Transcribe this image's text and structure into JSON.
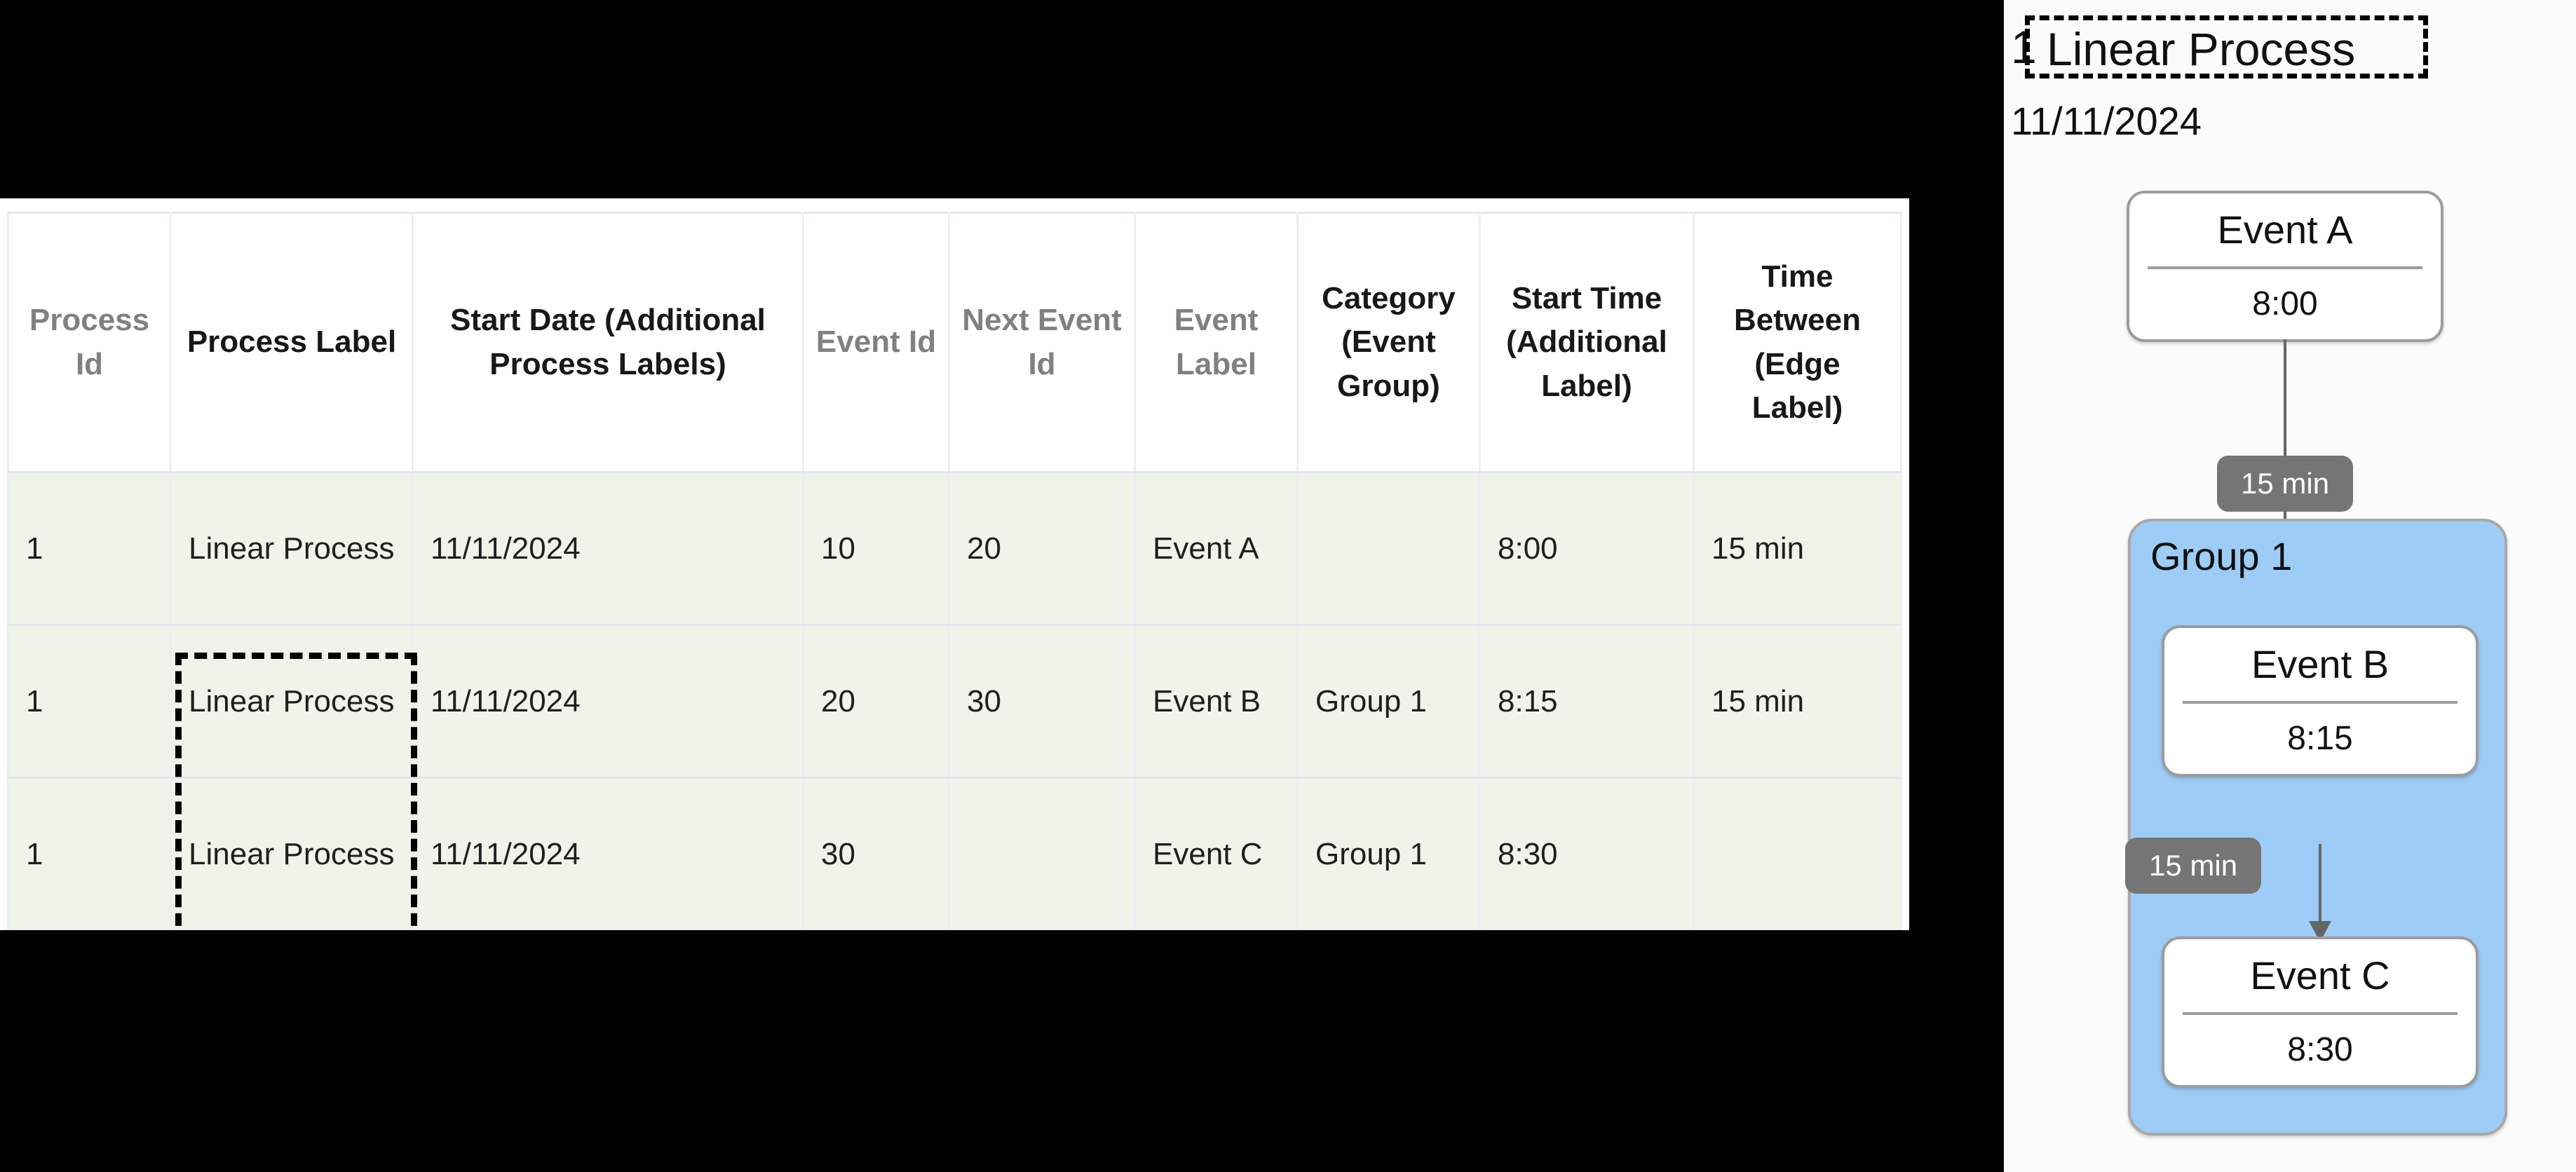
{
  "table": {
    "columns": [
      {
        "label": "Process Id",
        "style": "muted"
      },
      {
        "label": "Process Label",
        "style": "bold"
      },
      {
        "label": "Start Date (Additional Process Labels)",
        "style": "bold"
      },
      {
        "label": "Event Id",
        "style": "muted"
      },
      {
        "label": "Next Event Id",
        "style": "muted"
      },
      {
        "label": "Event Label",
        "style": "muted"
      },
      {
        "label": "Category (Event Group)",
        "style": "bold"
      },
      {
        "label": "Start Time (Additional Label)",
        "style": "bold"
      },
      {
        "label": "Time Between (Edge Label)",
        "style": "bold"
      }
    ],
    "rows": [
      {
        "process_id": "1",
        "process_label": "Linear Process",
        "start_date": "11/11/2024",
        "event_id": "10",
        "next_event_id": "20",
        "event_label": "Event A",
        "category": "",
        "start_time": "8:00",
        "time_between": "15 min"
      },
      {
        "process_id": "1",
        "process_label": "Linear Process",
        "start_date": "11/11/2024",
        "event_id": "20",
        "next_event_id": "30",
        "event_label": "Event B",
        "category": "Group 1",
        "start_time": "8:15",
        "time_between": "15 min"
      },
      {
        "process_id": "1",
        "process_label": "Linear Process",
        "start_date": "11/11/2024",
        "event_id": "30",
        "next_event_id": "",
        "event_label": "Event C",
        "category": "Group 1",
        "start_time": "8:30",
        "time_between": ""
      }
    ],
    "highlight": {
      "name": "process-label-column-highlight",
      "style": "dashed",
      "color": "#000000"
    }
  },
  "diagram": {
    "process_id": "1",
    "process_label": "Linear Process",
    "start_date": "11/11/2024",
    "group": {
      "label": "Group 1",
      "fill": "#9dcdf7",
      "border": "#a8a8a8"
    },
    "nodes": [
      {
        "title": "Event A",
        "subtitle": "8:00",
        "in_group": false
      },
      {
        "title": "Event B",
        "subtitle": "8:15",
        "in_group": true
      },
      {
        "title": "Event C",
        "subtitle": "8:30",
        "in_group": true
      }
    ],
    "edges": [
      {
        "from": "Event A",
        "to": "Event B",
        "label": "15 min"
      },
      {
        "from": "Event B",
        "to": "Event C",
        "label": "15 min"
      }
    ],
    "edge_label_color": "#757575",
    "edge_label_text_color": "#ffffff"
  }
}
